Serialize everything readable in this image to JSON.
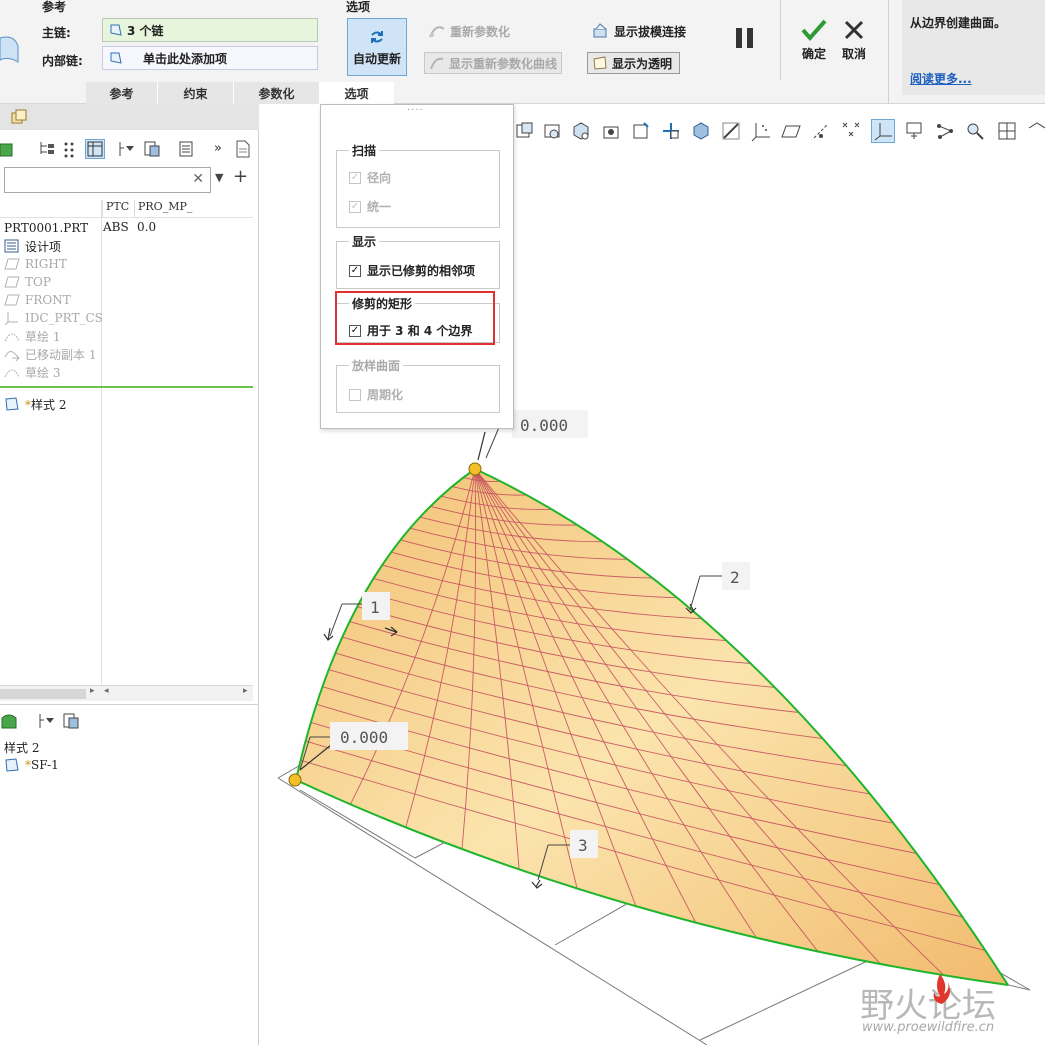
{
  "ribbon": {
    "reference_title": "参考",
    "options_title": "选项",
    "main_chain_label": "主链:",
    "main_chain_value": "3 个链",
    "inner_chain_label": "内部链:",
    "inner_chain_value": "单击此处添加项",
    "auto_update": "自动更新",
    "reparam": "重新参数化",
    "show_reparam_curves": "显示重新参数化曲线",
    "show_draft_connection": "显示拔模连接",
    "show_transparent": "显示为透明",
    "ok": "确定",
    "cancel": "取消",
    "tabs": [
      {
        "label": "参考"
      },
      {
        "label": "约束"
      },
      {
        "label": "参数化"
      },
      {
        "label": "选项"
      }
    ],
    "help_text": "从边界创建曲面。",
    "help_link": "阅读更多..."
  },
  "tree": {
    "columns": [
      "PTC",
      "PRO_MP_"
    ],
    "root": "PRT0001.PRT",
    "root_values": [
      "ABS",
      "0.0"
    ],
    "items": [
      {
        "label": "设计项"
      },
      {
        "label": "RIGHT"
      },
      {
        "label": "TOP"
      },
      {
        "label": "FRONT"
      },
      {
        "label": "IDC_PRT_CS"
      },
      {
        "label": "草绘 1"
      },
      {
        "label": "已移动副本 1"
      },
      {
        "label": "草绘 3"
      }
    ],
    "style_item": "样式 2",
    "lower_root": "样式 2",
    "lower_item": "SF-1"
  },
  "options": {
    "sweep_title": "扫描",
    "radial": "径向",
    "uniform": "统一",
    "display_title": "显示",
    "show_trimmed_adjacent": "显示已修剪的相邻项",
    "trim_rect_title": "修剪的矩形",
    "for_3_4_boundaries": "用于 3 和 4 个边界",
    "loft_title": "放样曲面",
    "periodic": "周期化"
  },
  "viewport": {
    "dims": [
      "0.000",
      "0.000"
    ],
    "chain_labels": [
      "1",
      "2",
      "3"
    ]
  },
  "watermark": {
    "title": "野火论坛",
    "url": "www.proewildfire.cn"
  },
  "colors": {
    "accent_active": "#cfe4f7",
    "chain_green": "#1fb52a",
    "highlight_red": "#e03030",
    "surface": "#f5cc8a"
  }
}
